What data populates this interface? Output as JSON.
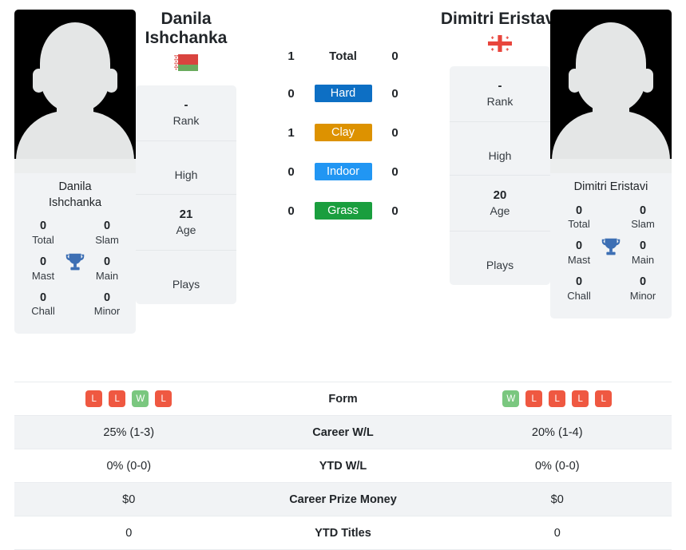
{
  "players": {
    "left": {
      "name": "Danila Ishchanka",
      "name_line1": "Danila",
      "name_line2": "Ishchanka",
      "photo_caption_line1": "Danila",
      "photo_caption_line2": "Ishchanka",
      "flag": "belarus-flag",
      "rank_value": "-",
      "rank_label": "Rank",
      "high_value": "",
      "high_label": "High",
      "age_value": "21",
      "age_label": "Age",
      "plays_value": "",
      "plays_label": "Plays",
      "titles": {
        "total_value": "0",
        "total_label": "Total",
        "slam_value": "0",
        "slam_label": "Slam",
        "mast_value": "0",
        "mast_label": "Mast",
        "main_value": "0",
        "main_label": "Main",
        "chall_value": "0",
        "chall_label": "Chall",
        "minor_value": "0",
        "minor_label": "Minor"
      },
      "form": [
        "L",
        "L",
        "W",
        "L"
      ],
      "career_wl": "25% (1-3)",
      "ytd_wl": "0% (0-0)",
      "career_prize_money": "$0",
      "ytd_titles": "0"
    },
    "right": {
      "name": "Dimitri Eristavi",
      "photo_caption": "Dimitri Eristavi",
      "flag": "georgia-flag",
      "rank_value": "-",
      "rank_label": "Rank",
      "high_value": "",
      "high_label": "High",
      "age_value": "20",
      "age_label": "Age",
      "plays_value": "",
      "plays_label": "Plays",
      "titles": {
        "total_value": "0",
        "total_label": "Total",
        "slam_value": "0",
        "slam_label": "Slam",
        "mast_value": "0",
        "mast_label": "Mast",
        "main_value": "0",
        "main_label": "Main",
        "chall_value": "0",
        "chall_label": "Chall",
        "minor_value": "0",
        "minor_label": "Minor"
      },
      "form": [
        "W",
        "L",
        "L",
        "L",
        "L"
      ],
      "career_wl": "20% (1-4)",
      "ytd_wl": "0% (0-0)",
      "career_prize_money": "$0",
      "ytd_titles": "0"
    }
  },
  "h2h": [
    {
      "label": "Total",
      "left": "1",
      "right": "0",
      "style": "plain",
      "color": ""
    },
    {
      "label": "Hard",
      "left": "0",
      "right": "0",
      "style": "badge",
      "color": "#0d6fc4"
    },
    {
      "label": "Clay",
      "left": "1",
      "right": "0",
      "style": "badge",
      "color": "#dd9200"
    },
    {
      "label": "Indoor",
      "left": "0",
      "right": "0",
      "style": "badge",
      "color": "#2196f3"
    },
    {
      "label": "Grass",
      "left": "0",
      "right": "0",
      "style": "badge",
      "color": "#1a9e3e"
    }
  ],
  "stats_rows": [
    {
      "label": "Form",
      "type": "form"
    },
    {
      "label": "Career W/L",
      "type": "text",
      "left": "25% (1-3)",
      "right": "20% (1-4)"
    },
    {
      "label": "YTD W/L",
      "type": "text",
      "left": "0% (0-0)",
      "right": "0% (0-0)"
    },
    {
      "label": "Career Prize Money",
      "type": "text",
      "left": "$0",
      "right": "$0"
    },
    {
      "label": "YTD Titles",
      "type": "text",
      "left": "0",
      "right": "0"
    }
  ],
  "colors": {
    "win_badge": "#7ac77f",
    "loss_badge": "#ef5841",
    "trophy": "#3d6fb4",
    "card_bg": "#f1f3f5"
  }
}
